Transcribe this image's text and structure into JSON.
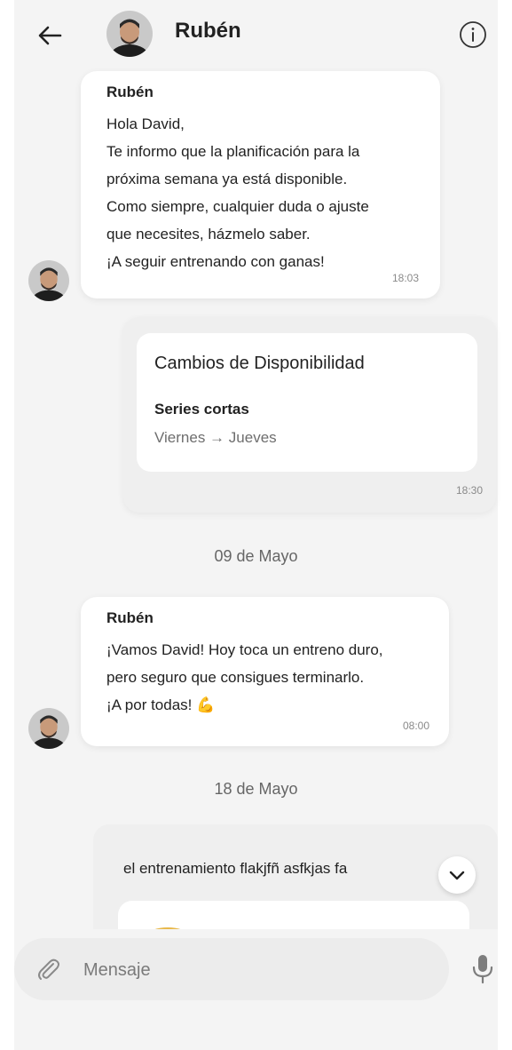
{
  "header": {
    "contact_name": "Rubén"
  },
  "messages": [
    {
      "sender": "Rubén",
      "lines": [
        "Hola David,",
        "Te informo que la planificación para la",
        "próxima semana ya está disponible.",
        "Como siempre, cualquier duda o ajuste",
        "que necesites, házmelo saber.",
        "¡A seguir entrenando con ganas!"
      ],
      "time": "18:03"
    },
    {
      "card_title": "Cambios de Disponibilidad",
      "card_subtitle": "Series cortas",
      "card_detail": "Viernes → Jueves",
      "time": "18:30"
    },
    {
      "sender": "Rubén",
      "lines": [
        "¡Vamos David! Hoy toca un entreno duro,",
        "pero seguro que consigues terminarlo.",
        "¡A por todas! 💪"
      ],
      "time": "08:00"
    },
    {
      "text": "el entrenamiento flakjfñ asfkjas fa"
    }
  ],
  "date_separators": [
    "09 de Mayo",
    "18 de Mayo"
  ],
  "composer": {
    "placeholder": "Mensaje"
  },
  "icons": {
    "back": "arrow-left-icon",
    "info": "info-circle-icon",
    "attach": "paperclip-icon",
    "mic": "microphone-icon",
    "scroll": "chevron-down-icon"
  }
}
